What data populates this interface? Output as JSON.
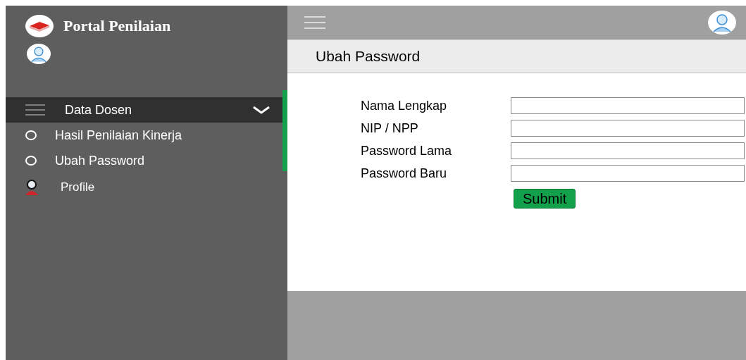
{
  "brand": {
    "title": "Portal Penilaian"
  },
  "sidebar": {
    "items": [
      {
        "kind": "group",
        "label": "Data Dosen",
        "expanded": true,
        "children": [
          {
            "label": "Hasil Penilaian Kinerja"
          },
          {
            "label": "Ubah Password"
          }
        ]
      },
      {
        "kind": "profile",
        "label": "Profile"
      }
    ]
  },
  "page": {
    "title": "Ubah Password"
  },
  "form": {
    "fields": [
      {
        "label": "Nama Lengkap"
      },
      {
        "label": "NIP / NPP"
      },
      {
        "label": "Password Lama"
      },
      {
        "label": "Password Baru"
      }
    ],
    "submit": "Submit"
  }
}
